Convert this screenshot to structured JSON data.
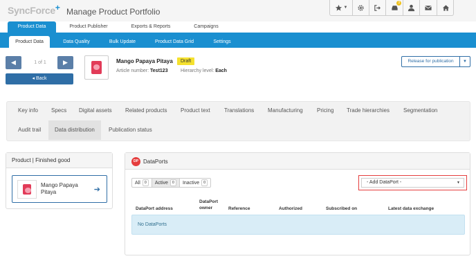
{
  "app": {
    "logo_text": "SyncForce",
    "logo_plus": "+",
    "title": "Manage Product Portfolio",
    "notification_count": "3"
  },
  "top_icons": [
    "star-dropdown-icon",
    "gear-icon",
    "sign-out-icon",
    "inbox-icon",
    "user-icon",
    "envelope-icon",
    "home-icon"
  ],
  "nav1": {
    "product_data": "Product Data",
    "product_publisher": "Product Publisher",
    "exports_reports": "Exports & Reports",
    "campaigns": "Campaigns"
  },
  "nav2": {
    "product_data": "Product Data",
    "data_quality": "Data Quality",
    "bulk_update": "Bulk Update",
    "product_data_grid": "Product Data Grid",
    "settings": "Settings"
  },
  "pager": {
    "text": "1 of 1",
    "back": "Back"
  },
  "product": {
    "name": "Mango Papaya Pitaya",
    "status": "Draft",
    "article_label": "Article number:",
    "article_value": "Test123",
    "hierarchy_label": "Hierarchy level:",
    "hierarchy_value": "Each",
    "release_label": "Release for publication"
  },
  "section_tabs": {
    "key_info": "Key info",
    "specs": "Specs",
    "digital_assets": "Digital assets",
    "related_products": "Related products",
    "product_text": "Product text",
    "translations": "Translations",
    "manufacturing": "Manufacturing",
    "pricing": "Pricing",
    "trade_hierarchies": "Trade hierarchies",
    "segmentation": "Segmentation",
    "audit_trail": "Audit trail",
    "data_distribution": "Data distribution",
    "publication_status": "Publication status"
  },
  "left_panel": {
    "header": "Product | Finished good",
    "card_name": "Mango Papaya Pitaya"
  },
  "dataports": {
    "logo": "DP",
    "title": "DataPorts",
    "filters": {
      "all_label": "All",
      "all_count": "0",
      "active_label": "Active",
      "active_count": "0",
      "inactive_label": "Inactive",
      "inactive_count": "0"
    },
    "add_select": "- Add DataPort -",
    "columns": {
      "address": "DataPort address",
      "owner": "DataPort owner",
      "reference": "Reference",
      "authorized": "Authorized",
      "subscribed": "Subscribed on",
      "latest": "Latest data exchange"
    },
    "empty": "No DataPorts"
  },
  "colors": {
    "brand_blue": "#1a8fd0",
    "button_blue": "#2f6ea6",
    "draft_yellow": "#f5e12e",
    "highlight_red": "#e53d3d",
    "empty_bg": "#d9edf7"
  }
}
